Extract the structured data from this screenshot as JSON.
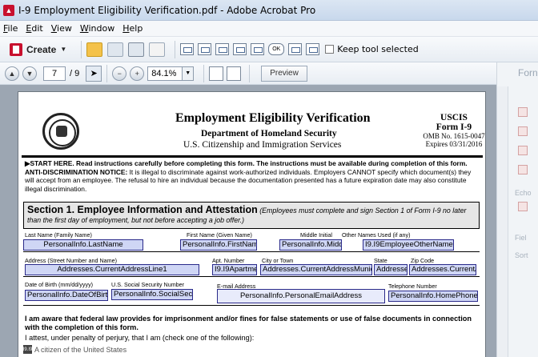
{
  "window": {
    "title": "I-9 Employment Eligibility Verification.pdf - Adobe Acrobat Pro"
  },
  "menu": [
    {
      "label": "File",
      "key": "F",
      "rest": "ile"
    },
    {
      "label": "Edit",
      "key": "E",
      "rest": "dit"
    },
    {
      "label": "View",
      "key": "V",
      "rest": "iew"
    },
    {
      "label": "Window",
      "key": "W",
      "rest": "indow"
    },
    {
      "label": "Help",
      "key": "H",
      "rest": "elp"
    }
  ],
  "toolbar": {
    "create_label": "Create",
    "ok_label": "OK",
    "keep_tool_label": "Keep tool selected"
  },
  "nav": {
    "page_value": "7",
    "page_total": "/ 9",
    "zoom_value": "84.1%",
    "preview_label": "Preview"
  },
  "right_panel": {
    "title": "Forn",
    "section1": "Echo",
    "section2": "Fiel",
    "section3": "Sort"
  },
  "document": {
    "title": "Employment Eligibility Verification",
    "department": "Department of Homeland Security",
    "agency": "U.S. Citizenship and Immigration Services",
    "uscis": "USCIS",
    "form_name": "Form I-9",
    "omb": "OMB No. 1615-0047",
    "expires": "Expires 03/31/2016",
    "start_here_bold": "▶START HERE.",
    "start_here_text": " Read instructions carefully before completing this form. The instructions must be available during completion of this form.",
    "anti_bold": "ANTI-DISCRIMINATION NOTICE:",
    "anti_text": " It is illegal to discriminate against work-authorized individuals. Employers CANNOT specify which document(s) they will accept from an employee. The refusal to hire an individual because the documentation presented has a future expiration date may also constitute illegal discrimination.",
    "section_title": "Section 1. Employee Information and Attestation",
    "section_note": " (Employees must complete and sign Section 1 of Form I-9 no later",
    "section_sub": "than the first day of employment, but not before accepting a job offer.)",
    "labels": {
      "last_name": "Last Name (Family Name)",
      "first_name": "First Name (Given Name)",
      "middle_initial": "Middle Initial",
      "other_names": "Other Names Used (if any)",
      "address": "Address (Street Number and Name)",
      "apt": "Apt. Number",
      "city": "City or Town",
      "state": "State",
      "zip": "Zip Code",
      "dob": "Date of Birth (mm/dd/yyyy)",
      "ssn": "U.S. Social Security Number",
      "email": "E-mail Address",
      "phone": "Telephone Number"
    },
    "fields": {
      "last_name": "PersonalInfo.LastName",
      "first_name": "PersonalInfo.FirstName",
      "middle_initial": "PersonalInfo.Midd",
      "other_names": "I9.I9EmployeeOtherNames",
      "address": "Addresses.CurrentAddressLine1",
      "apt": "I9.I9Apartmen",
      "city": "Addresses.CurrentAddressMunic",
      "state": "Addresses",
      "zip": "Addresses.Current/",
      "dob": "PersonalInfo.DateOfBirtl",
      "ssn": "PersonalInfo.SocialSecu",
      "email": "PersonalInfo.PersonalEmailAddress",
      "phone": "PersonalInfo.HomePhonel"
    },
    "attest_text": "I am aware that federal law provides for imprisonment and/or fines for false statements or use of false documents in connection with the completion of this form.",
    "attest2_text": "I attest, under penalty of perjury, that I am (check one of the following):",
    "option1_checkbox": "I9.I9",
    "option1": "A citizen of the United States"
  }
}
